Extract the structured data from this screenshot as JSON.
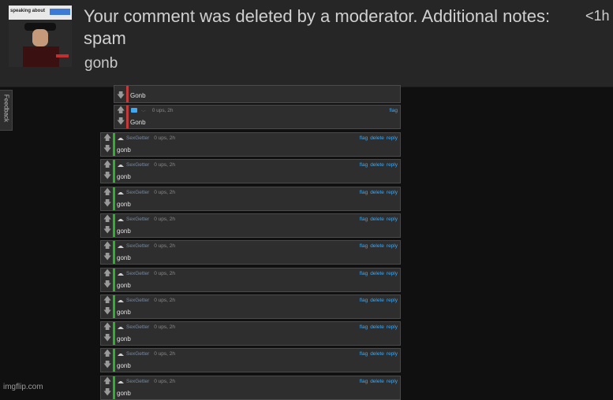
{
  "notification": {
    "title": "Your comment was deleted by a moderator. Additional notes: spam",
    "time": "<1h",
    "subtitle": "gonb",
    "thumbnail_caption": "speaking about"
  },
  "feedback_tab": {
    "label": "Feedback"
  },
  "top_comments": [
    {
      "username": "",
      "meta": "",
      "body": "Gonb",
      "actions": []
    },
    {
      "username": "·.·",
      "meta": "0 ups, 2h",
      "body": "Gonb",
      "actions": [
        "flag"
      ]
    }
  ],
  "comments": [
    {
      "username": "SexGetter",
      "meta": "0 ups, 2h",
      "body": "gonb",
      "actions": [
        "flag",
        "delete",
        "reply"
      ]
    },
    {
      "username": "SexGetter",
      "meta": "0 ups, 2h",
      "body": "gonb",
      "actions": [
        "flag",
        "delete",
        "reply"
      ]
    },
    {
      "username": "SexGetter",
      "meta": "0 ups, 2h",
      "body": "gonb",
      "actions": [
        "flag",
        "delete",
        "reply"
      ]
    },
    {
      "username": "SexGetter",
      "meta": "0 ups, 2h",
      "body": "gonb",
      "actions": [
        "flag",
        "delete",
        "reply"
      ]
    },
    {
      "username": "SexGetter",
      "meta": "0 ups, 2h",
      "body": "gonb",
      "actions": [
        "flag",
        "delete",
        "reply"
      ]
    },
    {
      "username": "SexGetter",
      "meta": "0 ups, 2h",
      "body": "gonb",
      "actions": [
        "flag",
        "delete",
        "reply"
      ]
    },
    {
      "username": "SexGetter",
      "meta": "0 ups, 2h",
      "body": "gonb",
      "actions": [
        "flag",
        "delete",
        "reply"
      ]
    },
    {
      "username": "SexGetter",
      "meta": "0 ups, 2h",
      "body": "gonb",
      "actions": [
        "flag",
        "delete",
        "reply"
      ]
    },
    {
      "username": "SexGetter",
      "meta": "0 ups, 2h",
      "body": "gonb",
      "actions": [
        "flag",
        "delete",
        "reply"
      ]
    },
    {
      "username": "SexGetter",
      "meta": "0 ups, 2h",
      "body": "gonb",
      "actions": [
        "flag",
        "delete",
        "reply"
      ]
    }
  ],
  "colors": {
    "accent_link": "#3fa9f5",
    "bar_green": "#2fb12f",
    "bar_red": "#c23a3a"
  },
  "watermark": "imgflip.com"
}
